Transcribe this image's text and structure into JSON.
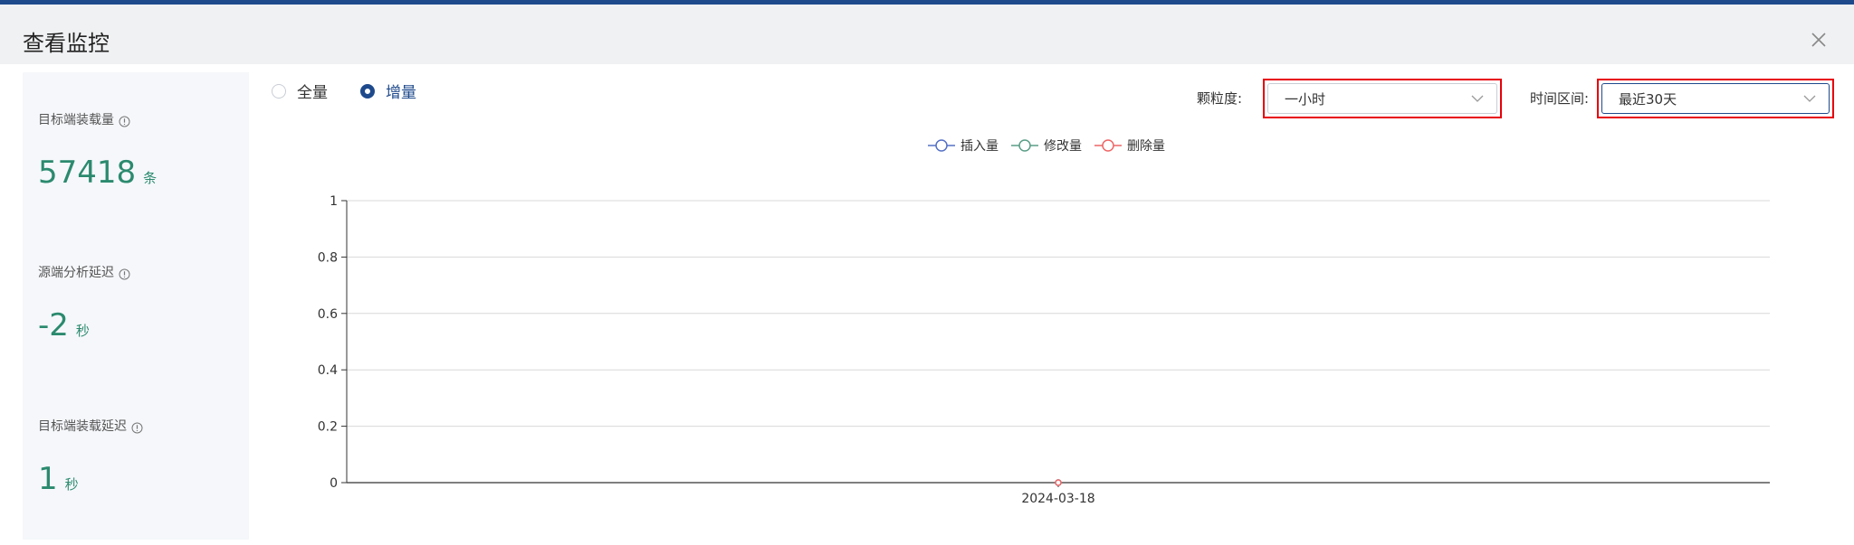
{
  "dialog": {
    "title": "查看监控"
  },
  "metrics": [
    {
      "label": "目标端装载量",
      "value": "57418",
      "unit": "条"
    },
    {
      "label": "源端分析延迟",
      "value": "-2",
      "unit": "秒"
    },
    {
      "label": "目标端装载延迟",
      "value": "1",
      "unit": "秒"
    }
  ],
  "mode": {
    "options": [
      "全量",
      "增量"
    ],
    "selected": "增量"
  },
  "filters": {
    "granularity_label": "颗粒度:",
    "granularity_value": "一小时",
    "range_label": "时间区间:",
    "range_value": "最近30天"
  },
  "colors": {
    "accent": "#1e4a8c",
    "metric": "#2b8a6e",
    "highlight": "#e8000b"
  },
  "chart_data": {
    "type": "line",
    "x": [
      "2024-03-18"
    ],
    "series": [
      {
        "name": "插入量",
        "values": [
          0
        ],
        "color": "#5470c6"
      },
      {
        "name": "修改量",
        "values": [
          0
        ],
        "color": "#5a9e87"
      },
      {
        "name": "删除量",
        "values": [
          0
        ],
        "color": "#ee6666"
      }
    ],
    "ylim": [
      0,
      1
    ],
    "yticks": [
      "1",
      "0.8",
      "0.6",
      "0.4",
      "0.2",
      "0"
    ],
    "grid": true,
    "legend_position": "top-center"
  }
}
